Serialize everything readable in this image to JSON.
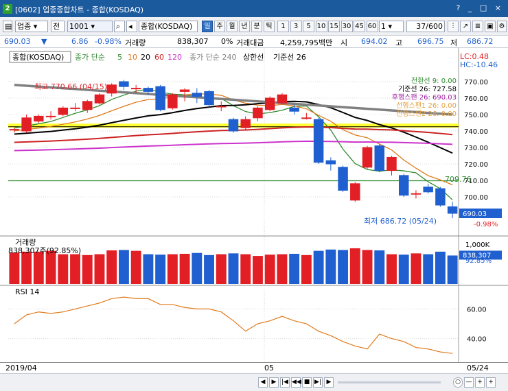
{
  "titlebar": {
    "num": "2",
    "text": "[0602] 업종종합차트 - 종합(KOSDAQ)",
    "controls": "? _ □ ×"
  },
  "toolbar": {
    "market": "업종",
    "all": "전",
    "code": "1001",
    "name": "종합(KOSDAQ)",
    "periods": [
      "일",
      "주",
      "월",
      "년",
      "분",
      "틱"
    ],
    "intervals": [
      "1",
      "3",
      "5",
      "10",
      "15",
      "30",
      "45",
      "60"
    ],
    "unit": "1",
    "page": "37/600"
  },
  "quote": {
    "price": "690.03",
    "arrow": "▼",
    "change": "6.86",
    "rate": "-0.98%",
    "vol_label": "거래량",
    "volume": "838,307",
    "pct": "0%",
    "amt_label": "거래대금",
    "amount": "4,259,795백만",
    "si": "시",
    "open": "694.02",
    "go": "고",
    "high": "696.75",
    "jeo": "저",
    "low": "686.72"
  },
  "legend": {
    "name": "종합(KOSDAQ)",
    "ma_label": "종가 단순",
    "ma_periods": [
      "5",
      "10",
      "20",
      "60",
      "120"
    ],
    "ma240": "종가 단순 240",
    "upper": "상한선",
    "base": "기준선 26"
  },
  "lchc": {
    "lc": "LC:0.48",
    "hc": "HC:-10.46"
  },
  "ichimoku": {
    "conv": "전환선 9: 0.00",
    "base": "기준선 26: 727.58",
    "lag": "후행스팬 26: 690.03",
    "span1": "선행스팬1 26: 0.00",
    "span2": "선행스팬2 26: 0.00"
  },
  "colors": {
    "up": "#e31f26",
    "down": "#1f5fcf",
    "ma5": "#2e8b2e",
    "ma10": "#e07a1b",
    "ma20": "#000000",
    "ma60": "#cc2222",
    "ma120": "#cc33cc",
    "ma240": "#808080",
    "rsi": "#e07a1b"
  },
  "chart_data": {
    "type": "candlestick",
    "ylim": [
      680,
      780
    ],
    "yticks": [
      "770.00",
      "760.00",
      "750.00",
      "740.00",
      "730.00",
      "720.00",
      "710.00",
      "700.00"
    ],
    "max_label": "최고 770.66 (04/15)",
    "min_label": "최저 686.72 (05/24)",
    "current_label": "690.03",
    "current_pct": "-0.98%",
    "line_label": "709.76",
    "candles": [
      {
        "o": 741,
        "c": 741,
        "h": 742,
        "l": 739
      },
      {
        "o": 740,
        "c": 748,
        "h": 750,
        "l": 739
      },
      {
        "o": 746,
        "c": 749,
        "h": 750,
        "l": 745
      },
      {
        "o": 749,
        "c": 749,
        "h": 752,
        "l": 747
      },
      {
        "o": 750,
        "c": 754,
        "h": 755,
        "l": 749
      },
      {
        "o": 754,
        "c": 754,
        "h": 757,
        "l": 752
      },
      {
        "o": 753,
        "c": 758,
        "h": 759,
        "l": 751
      },
      {
        "o": 757,
        "c": 762,
        "h": 763,
        "l": 756
      },
      {
        "o": 763,
        "c": 768,
        "h": 769,
        "l": 761
      },
      {
        "o": 770,
        "c": 767,
        "h": 771,
        "l": 765
      },
      {
        "o": 766,
        "c": 766,
        "h": 768,
        "l": 763
      },
      {
        "o": 766,
        "c": 764,
        "h": 767,
        "l": 762
      },
      {
        "o": 767,
        "c": 753,
        "h": 768,
        "l": 752
      },
      {
        "o": 754,
        "c": 762,
        "h": 763,
        "l": 753
      },
      {
        "o": 764,
        "c": 765,
        "h": 766,
        "l": 758
      },
      {
        "o": 763,
        "c": 761,
        "h": 766,
        "l": 757
      },
      {
        "o": 764,
        "c": 756,
        "h": 765,
        "l": 754
      },
      {
        "o": 755,
        "c": 755,
        "h": 758,
        "l": 752
      },
      {
        "o": 747,
        "c": 740,
        "h": 748,
        "l": 739
      },
      {
        "o": 742,
        "c": 747,
        "h": 749,
        "l": 741
      },
      {
        "o": 748,
        "c": 754,
        "h": 755,
        "l": 746
      },
      {
        "o": 753,
        "c": 760,
        "h": 761,
        "l": 752
      },
      {
        "o": 757,
        "c": 762,
        "h": 763,
        "l": 756
      },
      {
        "o": 754,
        "c": 752,
        "h": 756,
        "l": 750
      },
      {
        "o": 748,
        "c": 748,
        "h": 751,
        "l": 747
      },
      {
        "o": 747,
        "c": 721,
        "h": 748,
        "l": 720
      },
      {
        "o": 722,
        "c": 720,
        "h": 724,
        "l": 716
      },
      {
        "o": 718,
        "c": 704,
        "h": 719,
        "l": 703
      },
      {
        "o": 698,
        "c": 708,
        "h": 709,
        "l": 697
      },
      {
        "o": 718,
        "c": 730,
        "h": 731,
        "l": 717
      },
      {
        "o": 731,
        "c": 716,
        "h": 732,
        "l": 715
      },
      {
        "o": 716,
        "c": 724,
        "h": 725,
        "l": 713
      },
      {
        "o": 713,
        "c": 701,
        "h": 714,
        "l": 700
      },
      {
        "o": 702,
        "c": 702,
        "h": 704,
        "l": 699
      },
      {
        "o": 706,
        "c": 703,
        "h": 708,
        "l": 702
      },
      {
        "o": 705,
        "c": 695,
        "h": 706,
        "l": 694
      },
      {
        "o": 694,
        "c": 690,
        "h": 697,
        "l": 687
      }
    ],
    "volume": {
      "label": "거래량",
      "readout": "838,307주(92.85%)",
      "yticks": [
        "1,000K"
      ],
      "current": "838,307",
      "current_pct": "92.85%",
      "max": 1000,
      "values": [
        740,
        760,
        760,
        780,
        700,
        700,
        680,
        700,
        790,
        800,
        780,
        700,
        690,
        700,
        710,
        730,
        680,
        700,
        720,
        700,
        660,
        690,
        700,
        710,
        680,
        780,
        810,
        800,
        840,
        800,
        790,
        700,
        690,
        720,
        700,
        760,
        670
      ]
    },
    "rsi": {
      "label": "RSI 14",
      "ylim": [
        25,
        75
      ],
      "yticks": [
        "60.00",
        "40.00"
      ],
      "values": [
        50,
        56,
        58,
        57,
        58,
        60,
        62,
        64,
        67,
        68,
        67,
        67,
        63,
        63,
        61,
        60,
        60,
        58,
        52,
        45,
        50,
        52,
        55,
        52,
        50,
        45,
        42,
        38,
        35,
        33,
        43,
        40,
        38,
        34,
        33,
        31,
        30
      ]
    },
    "xlabels": [
      "2019/04",
      "05",
      "05/24"
    ]
  },
  "status": {
    "buttons": [
      "◀",
      "▶",
      "|◀",
      "◀◀",
      "■",
      "▶|",
      "▶"
    ],
    "zoom": [
      "○",
      "—",
      "+",
      "+"
    ]
  }
}
